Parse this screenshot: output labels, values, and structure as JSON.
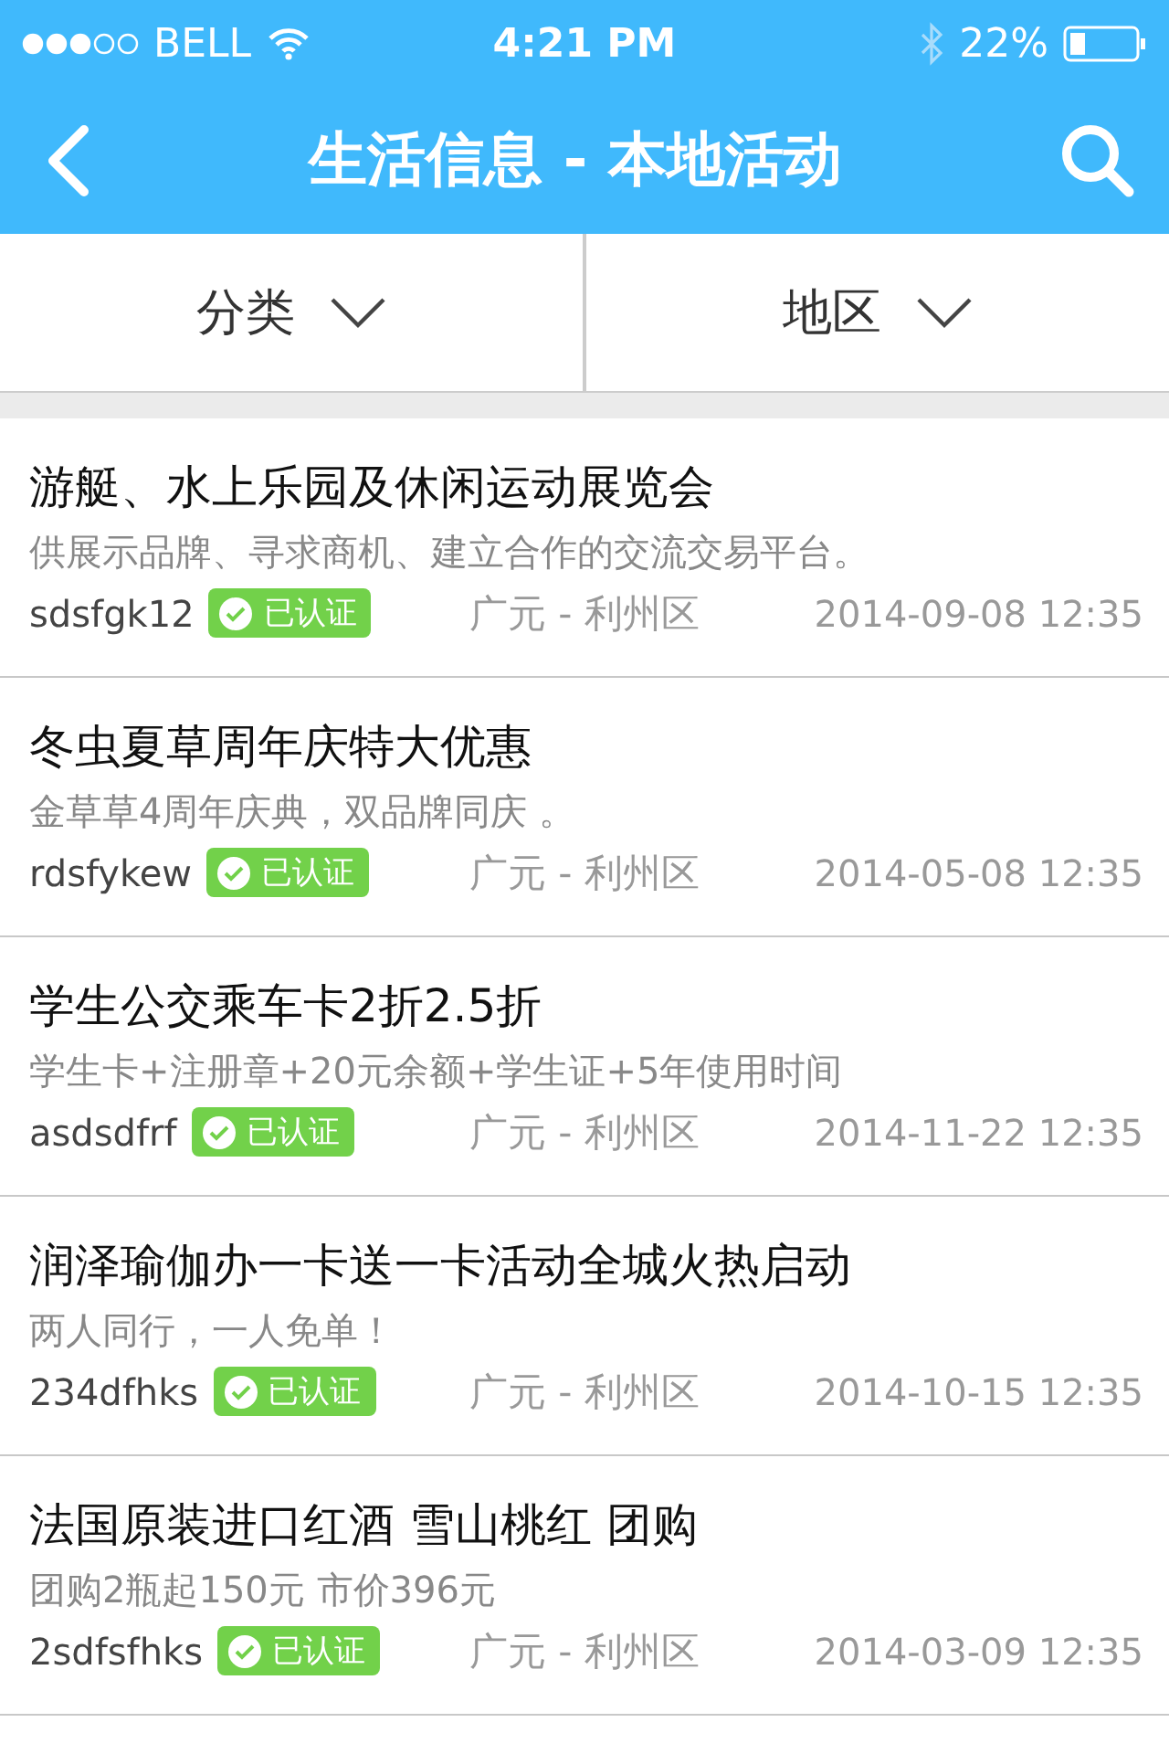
{
  "status_bar": {
    "carrier": "BELL",
    "time": "4:21 PM",
    "battery": "22%"
  },
  "nav": {
    "title": "生活信息 - 本地活动"
  },
  "filters": [
    {
      "label": "分类"
    },
    {
      "label": "地区"
    }
  ],
  "items": [
    {
      "title": "游艇、水上乐园及休闲运动展览会",
      "description": "供展示品牌、寻求商机、建立合作的交流交易平台。",
      "user": "sdsfgk12",
      "verified": true,
      "badge": "已认证",
      "location": "广元 - 利州区",
      "date": "2014-09-08 12:35"
    },
    {
      "title": "冬虫夏草周年庆特大优惠",
      "description": "金草草4周年庆典，双品牌同庆 。",
      "user": "rdsfykew",
      "verified": true,
      "badge": "已认证",
      "location": "广元 - 利州区",
      "date": "2014-05-08 12:35"
    },
    {
      "title": "学生公交乘车卡2折2.5折",
      "description": "学生卡+注册章+20元余额+学生证+5年使用时间",
      "user": "asdsdfrf",
      "verified": true,
      "badge": "已认证",
      "location": "广元 - 利州区",
      "date": "2014-11-22 12:35"
    },
    {
      "title": "润泽瑜伽办一卡送一卡活动全城火热启动",
      "description": "两人同行，一人免单！",
      "user": "234dfhks",
      "verified": true,
      "badge": "已认证",
      "location": "广元 - 利州区",
      "date": "2014-10-15 12:35"
    },
    {
      "title": "法国原装进口红酒 雪山桃红 团购",
      "description": "团购2瓶起150元 市价396元",
      "user": "2sdfsfhks",
      "verified": true,
      "badge": "已认证",
      "location": "广元 - 利州区",
      "date": "2014-03-09 12:35"
    }
  ]
}
